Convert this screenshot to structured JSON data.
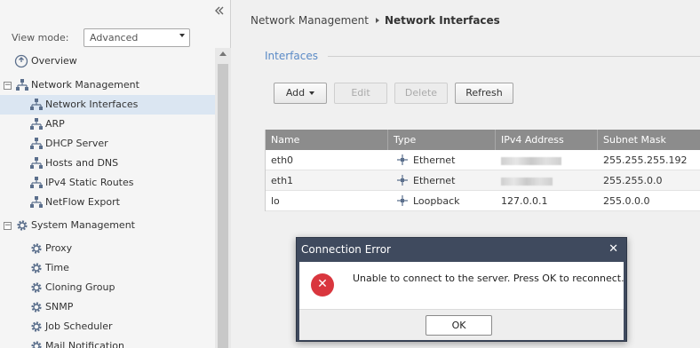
{
  "sidebar": {
    "collapse_icon": "double-chevron-left-icon",
    "view_mode_label": "View mode:",
    "view_mode_value": "Advanced",
    "items": [
      {
        "label": "Overview",
        "icon": "overview-icon"
      },
      {
        "label": "Network Management",
        "icon": "network-icon",
        "expander": "⊟"
      },
      {
        "label": "Network Interfaces",
        "icon": "network-icon",
        "selected": true
      },
      {
        "label": "ARP",
        "icon": "network-icon"
      },
      {
        "label": "DHCP Server",
        "icon": "network-icon"
      },
      {
        "label": "Hosts and DNS",
        "icon": "network-icon"
      },
      {
        "label": "IPv4 Static Routes",
        "icon": "network-icon"
      },
      {
        "label": "NetFlow Export",
        "icon": "network-icon"
      },
      {
        "label": "System Management",
        "icon": "gear-icon",
        "expander": "⊟"
      },
      {
        "label": "Proxy",
        "icon": "gear-icon"
      },
      {
        "label": "Time",
        "icon": "gear-icon"
      },
      {
        "label": "Cloning Group",
        "icon": "gear-icon"
      },
      {
        "label": "SNMP",
        "icon": "gear-icon"
      },
      {
        "label": "Job Scheduler",
        "icon": "gear-icon"
      },
      {
        "label": "Mail Notification",
        "icon": "gear-icon"
      }
    ]
  },
  "breadcrumb": {
    "parent": "Network Management",
    "current": "Network Interfaces"
  },
  "section": {
    "title": "Interfaces"
  },
  "toolbar": {
    "add_label": "Add",
    "edit_label": "Edit",
    "delete_label": "Delete",
    "refresh_label": "Refresh"
  },
  "table": {
    "columns": [
      "Name",
      "Type",
      "IPv4 Address",
      "Subnet Mask"
    ],
    "rows": [
      {
        "name": "eth0",
        "type": "Ethernet",
        "ipv4": "",
        "mask": "255.255.255.192"
      },
      {
        "name": "eth1",
        "type": "Ethernet",
        "ipv4": "",
        "mask": "255.255.0.0"
      },
      {
        "name": "lo",
        "type": "Loopback",
        "ipv4": "127.0.0.1",
        "mask": "255.0.0.0"
      }
    ]
  },
  "dialog": {
    "title": "Connection Error",
    "close_icon": "close-icon",
    "message": "Unable to connect to the server. Press OK to reconnect.",
    "error_icon": "error-icon",
    "ok_label": "OK"
  },
  "colors": {
    "accent": "#5a8ac6",
    "header_gray": "#8c8c8c",
    "dialog_frame": "#3f4a5e",
    "error_red": "#d9363e",
    "selected_row": "#dbe6f2"
  }
}
